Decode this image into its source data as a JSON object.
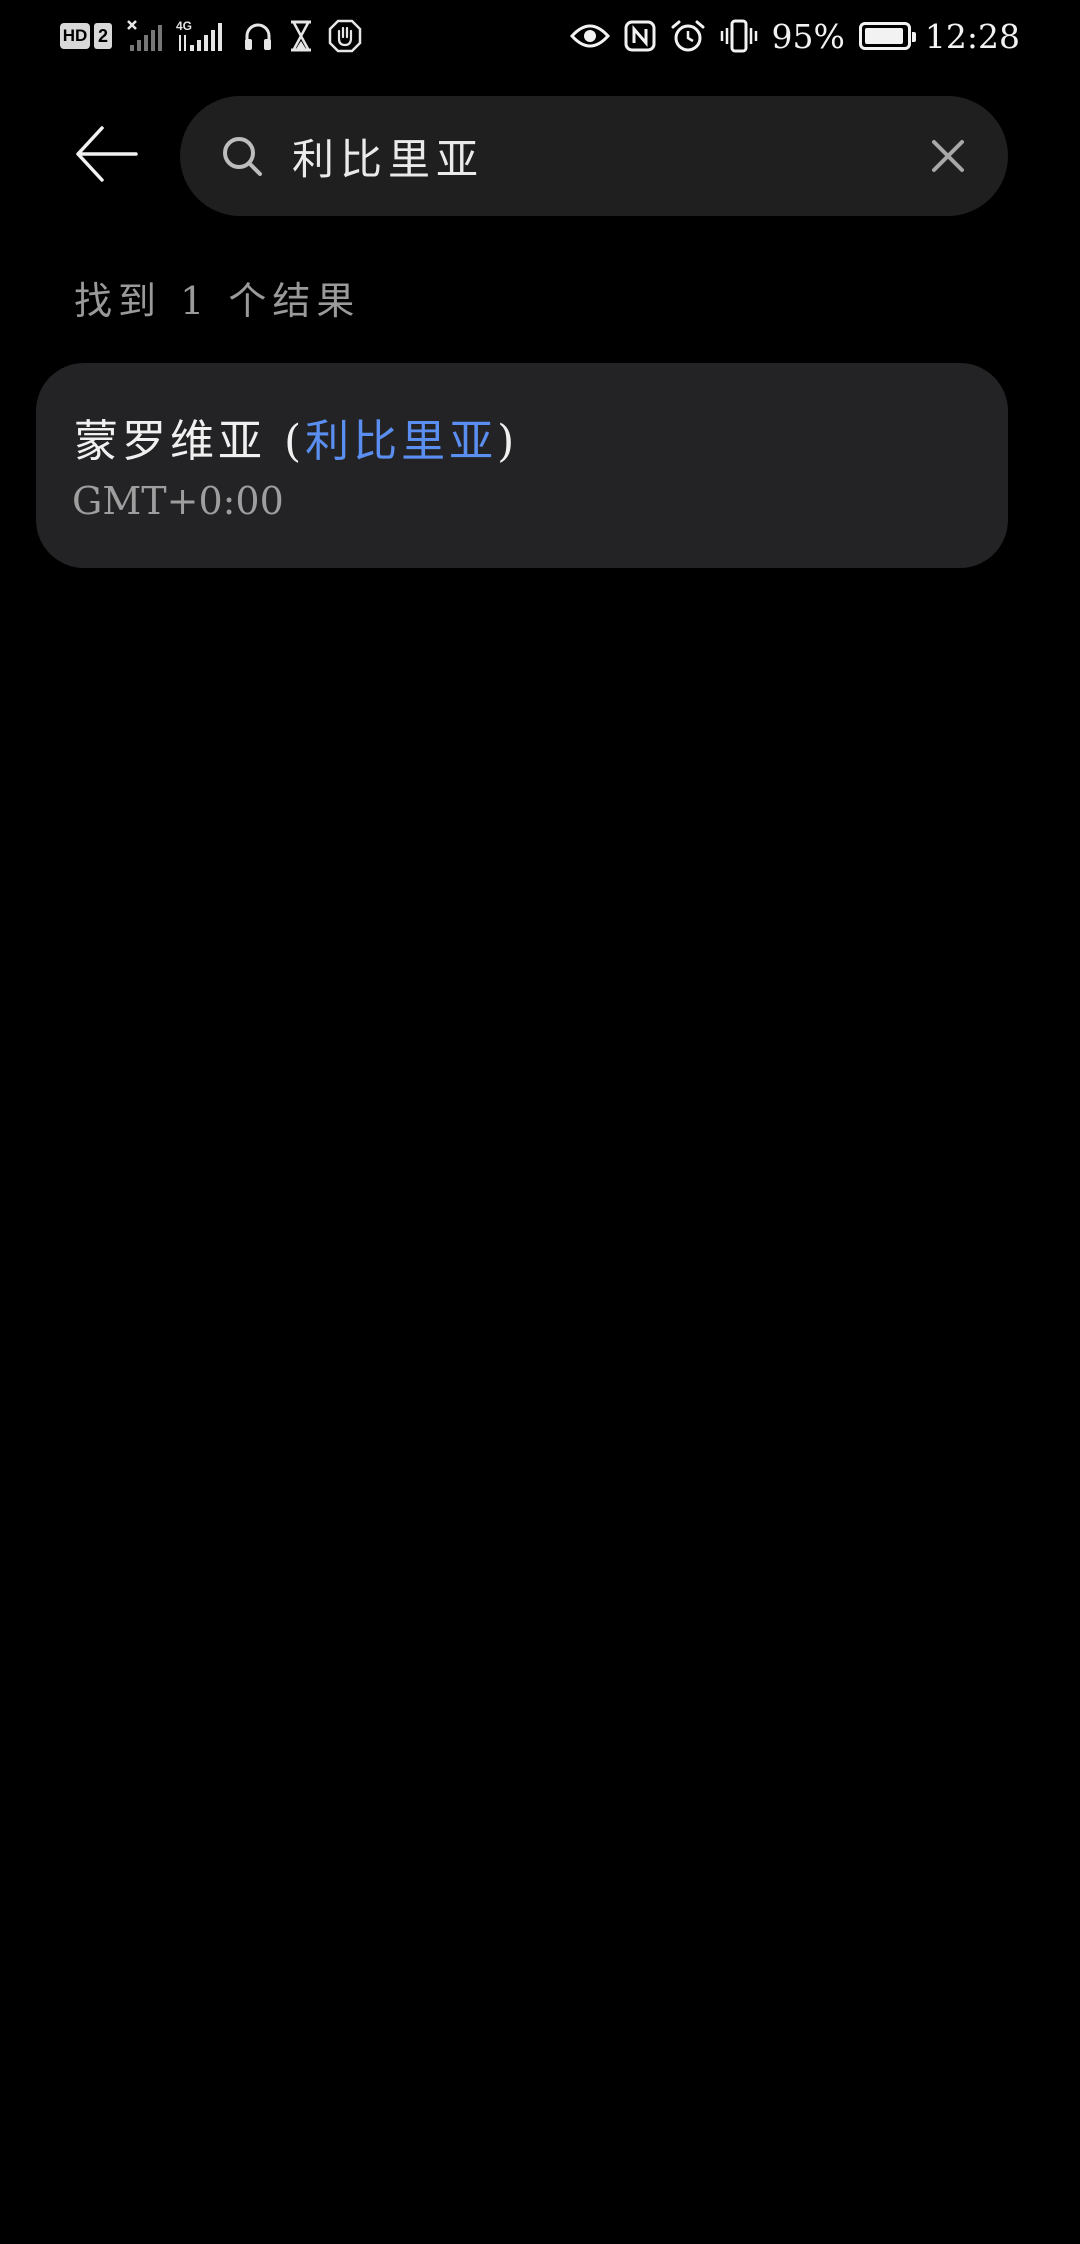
{
  "status_bar": {
    "left_icons": [
      "hd-icon",
      "sim2-icon",
      "no-signal-icon",
      "4g-signal-icon",
      "headphones-icon",
      "hourglass-icon",
      "hand-icon"
    ],
    "hd_label": "HD",
    "sim_label": "2",
    "network_label": "4G",
    "right_icons": [
      "eye-icon",
      "nfc-icon",
      "alarm-icon",
      "vibrate-icon"
    ],
    "battery_percent": "95%",
    "battery_level": 0.95,
    "time": "12:28"
  },
  "search": {
    "query": "利比里亚"
  },
  "results": {
    "count_text": "找到 1 个结果",
    "items": [
      {
        "name": "蒙罗维亚",
        "paren_open": " (",
        "country": "利比里亚",
        "paren_close": ")",
        "timezone": "GMT+0:00"
      }
    ]
  },
  "colors": {
    "background": "#000000",
    "search_box": "#1f1f1f",
    "card": "#232325",
    "highlight": "#5a8ef0",
    "secondary_text": "#9a9a9a"
  }
}
